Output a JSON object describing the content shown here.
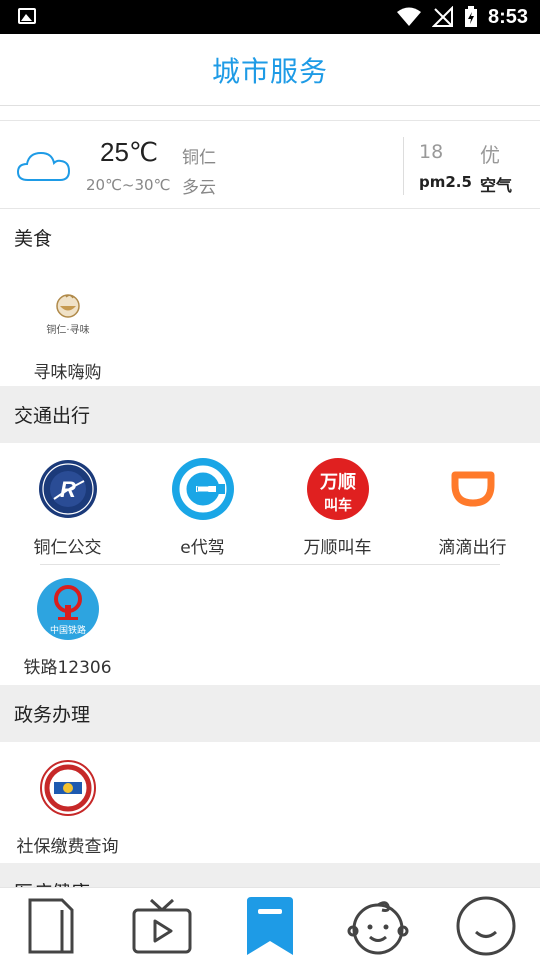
{
  "status_bar": {
    "time": "8:53",
    "icons": [
      "image-icon",
      "wifi-icon",
      "no-signal-icon",
      "battery-charging-icon"
    ]
  },
  "header": {
    "title": "城市服务"
  },
  "weather": {
    "icon": "cloud-icon",
    "temperature": "25℃",
    "range": "20℃~30℃",
    "city": "铜仁",
    "condition": "多云",
    "aqi_value": "18",
    "aqi_label": "pm2.5",
    "aqi_quality": "优",
    "aqi_air": "空气"
  },
  "sections": [
    {
      "title": "美食",
      "items": [
        {
          "label": "寻味嗨购",
          "logo_text": "铜仁·寻味"
        }
      ]
    },
    {
      "title": "交通出行",
      "items": [
        {
          "label": "铜仁公交"
        },
        {
          "label": "e代驾"
        },
        {
          "label": "万顺叫车",
          "logo_text_top": "万顺",
          "logo_text_bottom": "叫车"
        },
        {
          "label": "滴滴出行"
        },
        {
          "label": "铁路12306",
          "logo_text": "中国铁路"
        }
      ]
    },
    {
      "title": "政务办理",
      "items": [
        {
          "label": "社保缴费查询"
        }
      ]
    },
    {
      "title": "医疗健康"
    }
  ],
  "bottom_nav": [
    {
      "name": "document-icon"
    },
    {
      "name": "tv-icon"
    },
    {
      "name": "bookmark-icon",
      "active": true
    },
    {
      "name": "baby-icon"
    },
    {
      "name": "smile-icon"
    }
  ],
  "colors": {
    "accent": "#1e9be6",
    "didi": "#ff7a2b",
    "wanshun": "#e02020",
    "section_bg": "#eeeeee"
  }
}
